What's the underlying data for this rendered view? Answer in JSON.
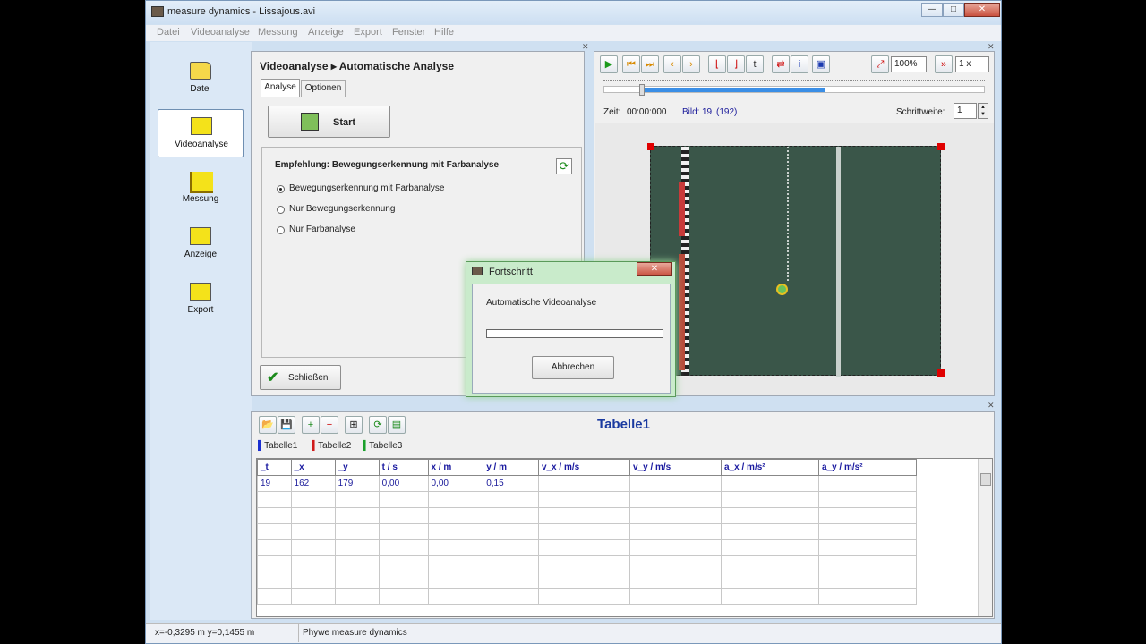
{
  "window": {
    "title": "measure dynamics - Lissajous.avi",
    "min_label": "—",
    "max_label": "□",
    "close_label": "✕"
  },
  "menu": [
    "Datei",
    "Videoanalyse",
    "Messung",
    "Anzeige",
    "Export",
    "Fenster",
    "Hilfe"
  ],
  "sidebar": {
    "items": [
      {
        "label": "Datei",
        "icon": "folder-icon"
      },
      {
        "label": "Videoanalyse",
        "icon": "video-camera-icon"
      },
      {
        "label": "Messung",
        "icon": "ruler-icon"
      },
      {
        "label": "Anzeige",
        "icon": "display-sign-icon"
      },
      {
        "label": "Export",
        "icon": "truck-icon"
      }
    ]
  },
  "analysis": {
    "breadcrumb_1": "Videoanalyse",
    "breadcrumb_sep": "▸",
    "breadcrumb_2": "Automatische Analyse",
    "tabs": [
      "Analyse",
      "Optionen"
    ],
    "start_label": "Start",
    "recommendation": "Empfehlung: Bewegungserkennung mit Farbanalyse",
    "options": [
      "Bewegungserkennung mit Farbanalyse",
      "Nur Bewegungserkennung",
      "Nur Farbanalyse"
    ],
    "selected_option": 0,
    "close_label": "Schließen"
  },
  "video": {
    "zoom": "100%",
    "speed": "1 x",
    "time_label": "Zeit:",
    "time_value": "00:00:000",
    "frame_label": "Bild:",
    "frame_value": "19",
    "frame_total": "(192)",
    "step_label": "Schrittweite:",
    "step_value": "1",
    "progress_fraction": 0.1
  },
  "dialog": {
    "title": "Fortschritt",
    "message": "Automatische Videoanalyse",
    "progress": 0,
    "cancel_label": "Abbrechen"
  },
  "table_panel": {
    "title": "Tabelle1",
    "tabs": [
      {
        "label": "Tabelle1",
        "color": "#1b2fd0"
      },
      {
        "label": "Tabelle2",
        "color": "#d01b1b"
      },
      {
        "label": "Tabelle3",
        "color": "#1ba02b"
      }
    ],
    "columns": [
      "_t",
      "_x",
      "_y",
      "t / s",
      "x / m",
      "y / m",
      "v_x / m/s",
      "v_y / m/s",
      "a_x / m/s²",
      "a_y / m/s²"
    ],
    "rows": [
      [
        "19",
        "162",
        "179",
        "0,00",
        "0,00",
        "0,15",
        "",
        "",
        "",
        ""
      ]
    ]
  },
  "status": {
    "coords": "x=-0,3295 m  y=0,1455 m",
    "app": "Phywe measure dynamics"
  }
}
